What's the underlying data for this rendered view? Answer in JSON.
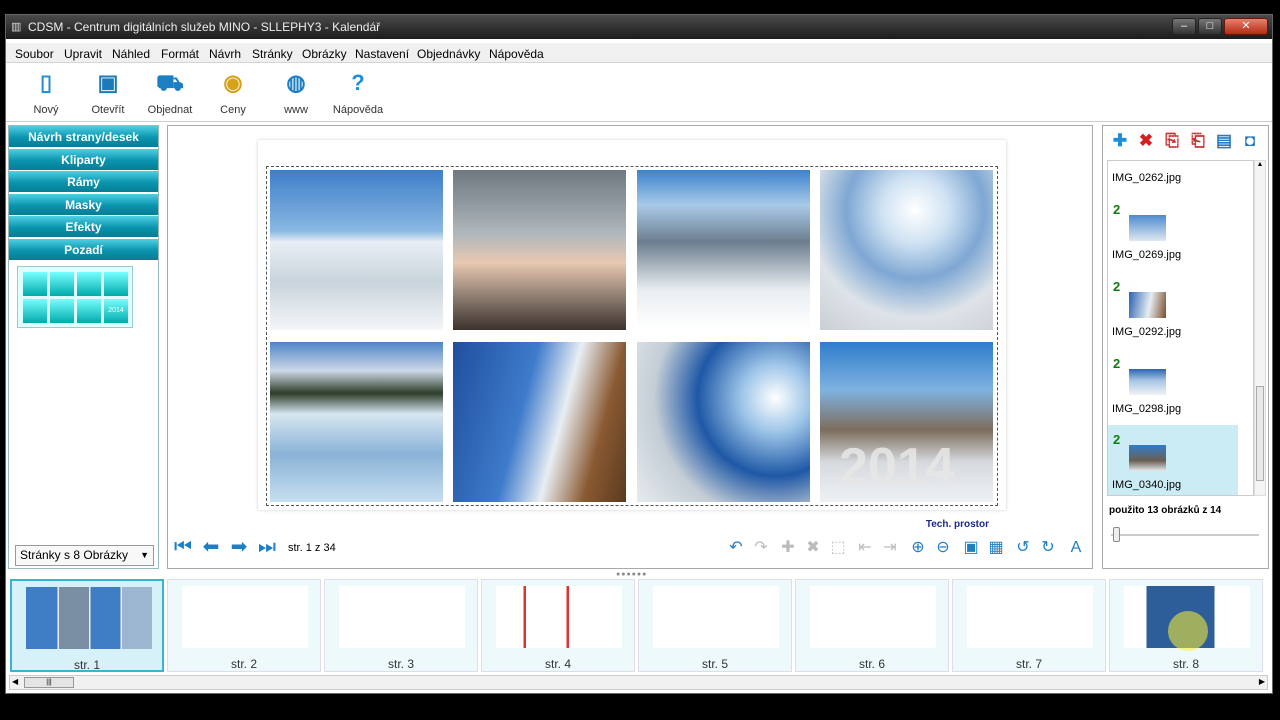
{
  "window": {
    "title": "CDSM - Centrum digitálních služeb MINO - SLLEPHY3 - Kalendář"
  },
  "menu": [
    "Soubor",
    "Upravit",
    "Náhled",
    "Formát",
    "Návrh",
    "Stránky",
    "Obrázky",
    "Nastavení",
    "Objednávky",
    "Nápověda"
  ],
  "toolbar": [
    "Nový",
    "Otevřít",
    "Objednat",
    "Ceny",
    "www",
    "Nápověda"
  ],
  "left": {
    "buttons": [
      "Návrh strany/desek",
      "Kliparty",
      "Rámy",
      "Masky",
      "Efekty",
      "Pozadí"
    ],
    "mask_label": "2014",
    "page_select": "Stránky s 8 Obrázky"
  },
  "editor": {
    "year": "2014",
    "footer": "Tech. prostor",
    "page_counter": "str. 1 z 34"
  },
  "right": {
    "files": [
      {
        "count": "",
        "name": "IMG_0262.jpg"
      },
      {
        "count": "2",
        "name": "IMG_0269.jpg"
      },
      {
        "count": "2",
        "name": "IMG_0292.jpg"
      },
      {
        "count": "2",
        "name": "IMG_0298.jpg"
      },
      {
        "count": "2",
        "name": "IMG_0340.jpg"
      }
    ],
    "usage": "použito 13 obrázků z  14"
  },
  "pages": [
    "str. 1",
    "str. 2",
    "str. 3",
    "str. 4",
    "str. 5",
    "str. 6",
    "str. 7",
    "str. 8"
  ],
  "colors": {
    "accent": "#0a94ad",
    "selection": "#36b4d4",
    "icon_blue": "#1c7fc3",
    "delete_red": "#d42020"
  }
}
